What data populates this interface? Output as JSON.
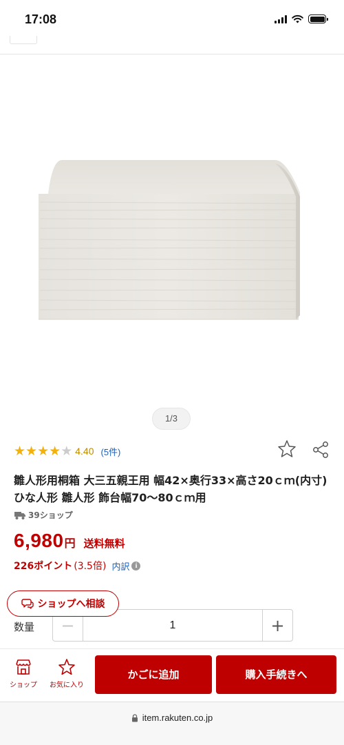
{
  "status_bar": {
    "time": "17:08"
  },
  "product": {
    "image_counter": "1/3",
    "rating": {
      "value": "4.40",
      "stars_filled": 4,
      "stars_total": 5,
      "review_count": "(5件)"
    },
    "title": "雛人形用桐箱 大三五親王用 幅42×奥行33×高さ20ｃｍ(内寸) ひな人形 雛人形 飾台幅70〜80ｃｍ用",
    "shop_label": "39ショップ",
    "price": {
      "value": "6,980",
      "unit": "円",
      "shipping": "送料無料"
    },
    "points": {
      "value": "226ポイント",
      "rate": "(3.5倍)",
      "breakdown": "内訳",
      "info_glyph": "i"
    }
  },
  "consult_button": {
    "label": "ショップへ相談"
  },
  "quantity": {
    "label": "数量",
    "value": "1",
    "minus": "−",
    "plus": "+"
  },
  "action_bar": {
    "shop_label": "ショップ",
    "favorite_label": "お気に入り",
    "cart_label": "かごに追加",
    "buy_label": "購入手続きへ"
  },
  "browser": {
    "url": "item.rakuten.co.jp"
  },
  "colors": {
    "accent": "#bf0000",
    "star": "#f2b10d",
    "star_empty": "#cccccc",
    "link": "#1e5fb8"
  },
  "icons": [
    "signal-icon",
    "wifi-icon",
    "battery-icon",
    "star-icon",
    "share-icon",
    "truck-icon",
    "info-icon",
    "chat-icon",
    "shop-icon",
    "favorite-star-icon",
    "lock-icon"
  ]
}
